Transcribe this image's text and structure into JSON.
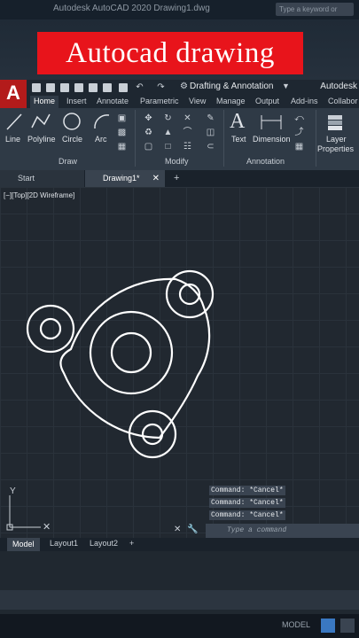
{
  "window": {
    "title": "Autodesk AutoCAD 2020   Drawing1.dwg",
    "search_placeholder": "Type a keyword or phrase"
  },
  "overlay": {
    "title": "Autocad drawing"
  },
  "quick_access": {
    "workspace": "Drafting & Annotation",
    "brand": "Autodesk"
  },
  "ribbon_tabs": [
    "Home",
    "Insert",
    "Annotate",
    "Parametric",
    "View",
    "Manage",
    "Output",
    "Add-ins",
    "Collabor"
  ],
  "ribbon": {
    "draw": {
      "line": "Line",
      "polyline": "Polyline",
      "circle": "Circle",
      "arc": "Arc",
      "panel": "Draw"
    },
    "modify": {
      "panel": "Modify"
    },
    "annotation": {
      "text": "Text",
      "dimension": "Dimension",
      "panel": "Annotation"
    },
    "layers": {
      "label1": "Layer",
      "label2": "Properties"
    }
  },
  "doc_tabs": {
    "start": "Start",
    "active": "Drawing1*"
  },
  "viewport": {
    "label": "[−][Top][2D Wireframe]"
  },
  "ucs": {
    "y": "Y"
  },
  "command": {
    "history": [
      "Command: *Cancel*",
      "Command: *Cancel*",
      "Command: *Cancel*"
    ],
    "placeholder": "Type a command"
  },
  "layout_tabs": {
    "model": "Model",
    "layout1": "Layout1",
    "layout2": "Layout2"
  },
  "status": {
    "model": "MODEL"
  }
}
